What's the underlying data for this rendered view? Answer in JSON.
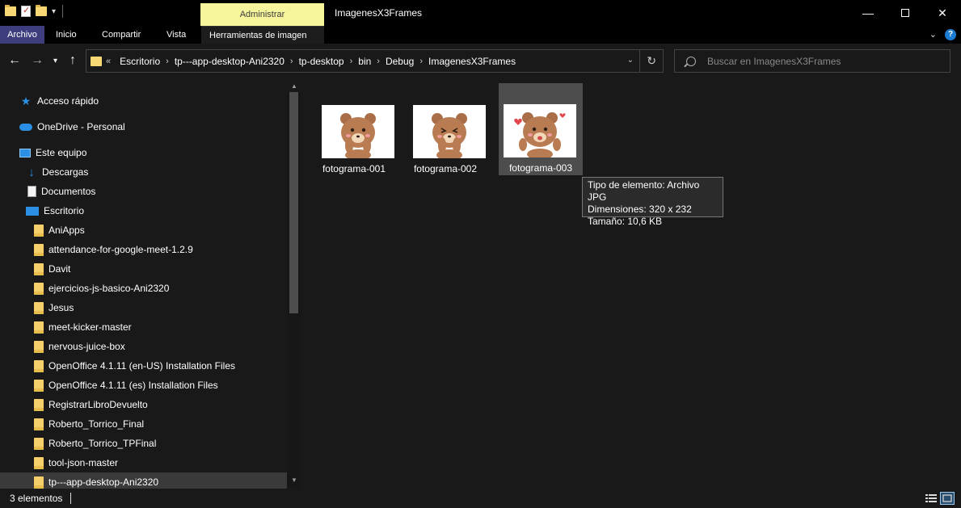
{
  "window": {
    "title": "ImagenesX3Frames",
    "context_tab_header": "Administrar",
    "minimize_glyph": "—",
    "close_glyph": "✕"
  },
  "ribbon": {
    "tabs": [
      {
        "label": "Archivo"
      },
      {
        "label": "Inicio"
      },
      {
        "label": "Compartir"
      },
      {
        "label": "Vista"
      },
      {
        "label": "Herramientas de imagen"
      }
    ],
    "expand_glyph": "⌄",
    "help_glyph": "?"
  },
  "nav": {
    "back_glyph": "←",
    "forward_glyph": "→",
    "recent_glyph": "⌄",
    "up_glyph": "↑",
    "overflow_glyph": "«",
    "breadcrumb": [
      "Escritorio",
      "tp---app-desktop-Ani2320",
      "tp-desktop",
      "bin",
      "Debug",
      "ImagenesX3Frames"
    ],
    "crumb_sep_glyph": "›",
    "dropdown_glyph": "⌄",
    "refresh_glyph": "↻",
    "search_placeholder": "Buscar en ImagenesX3Frames"
  },
  "sidebar": {
    "quick_access": "Acceso rápido",
    "onedrive": "OneDrive - Personal",
    "this_pc": "Este equipo",
    "downloads": "Descargas",
    "documents": "Documentos",
    "desktop": "Escritorio",
    "folders": [
      "AniApps",
      "attendance-for-google-meet-1.2.9",
      "Davit",
      "ejercicios-js-basico-Ani2320",
      "Jesus",
      "meet-kicker-master",
      "nervous-juice-box",
      "OpenOffice 4.1.11 (en-US) Installation Files",
      "OpenOffice 4.1.11 (es) Installation Files",
      "RegistrarLibroDevuelto",
      "Roberto_Torrico_Final",
      "Roberto_Torrico_TPFinal",
      "tool-json-master",
      "tp---app-desktop-Ani2320"
    ],
    "scroll_up_glyph": "▲",
    "scroll_down_glyph": "▼"
  },
  "files": [
    {
      "name": "fotograma-001"
    },
    {
      "name": "fotograma-002"
    },
    {
      "name": "fotograma-003"
    }
  ],
  "tooltip": {
    "line1": "Tipo de elemento: Archivo JPG",
    "line2": "Dimensiones: 320 x 232",
    "line3": "Tamaño: 10,6 KB"
  },
  "status": {
    "count": "3 elementos"
  },
  "colors": {
    "background": "#191919",
    "selection": "#4d4d4d",
    "accent": "#2b8fe4",
    "file_tab": "#3e3e7e",
    "context_tab": "#f7f59c"
  }
}
